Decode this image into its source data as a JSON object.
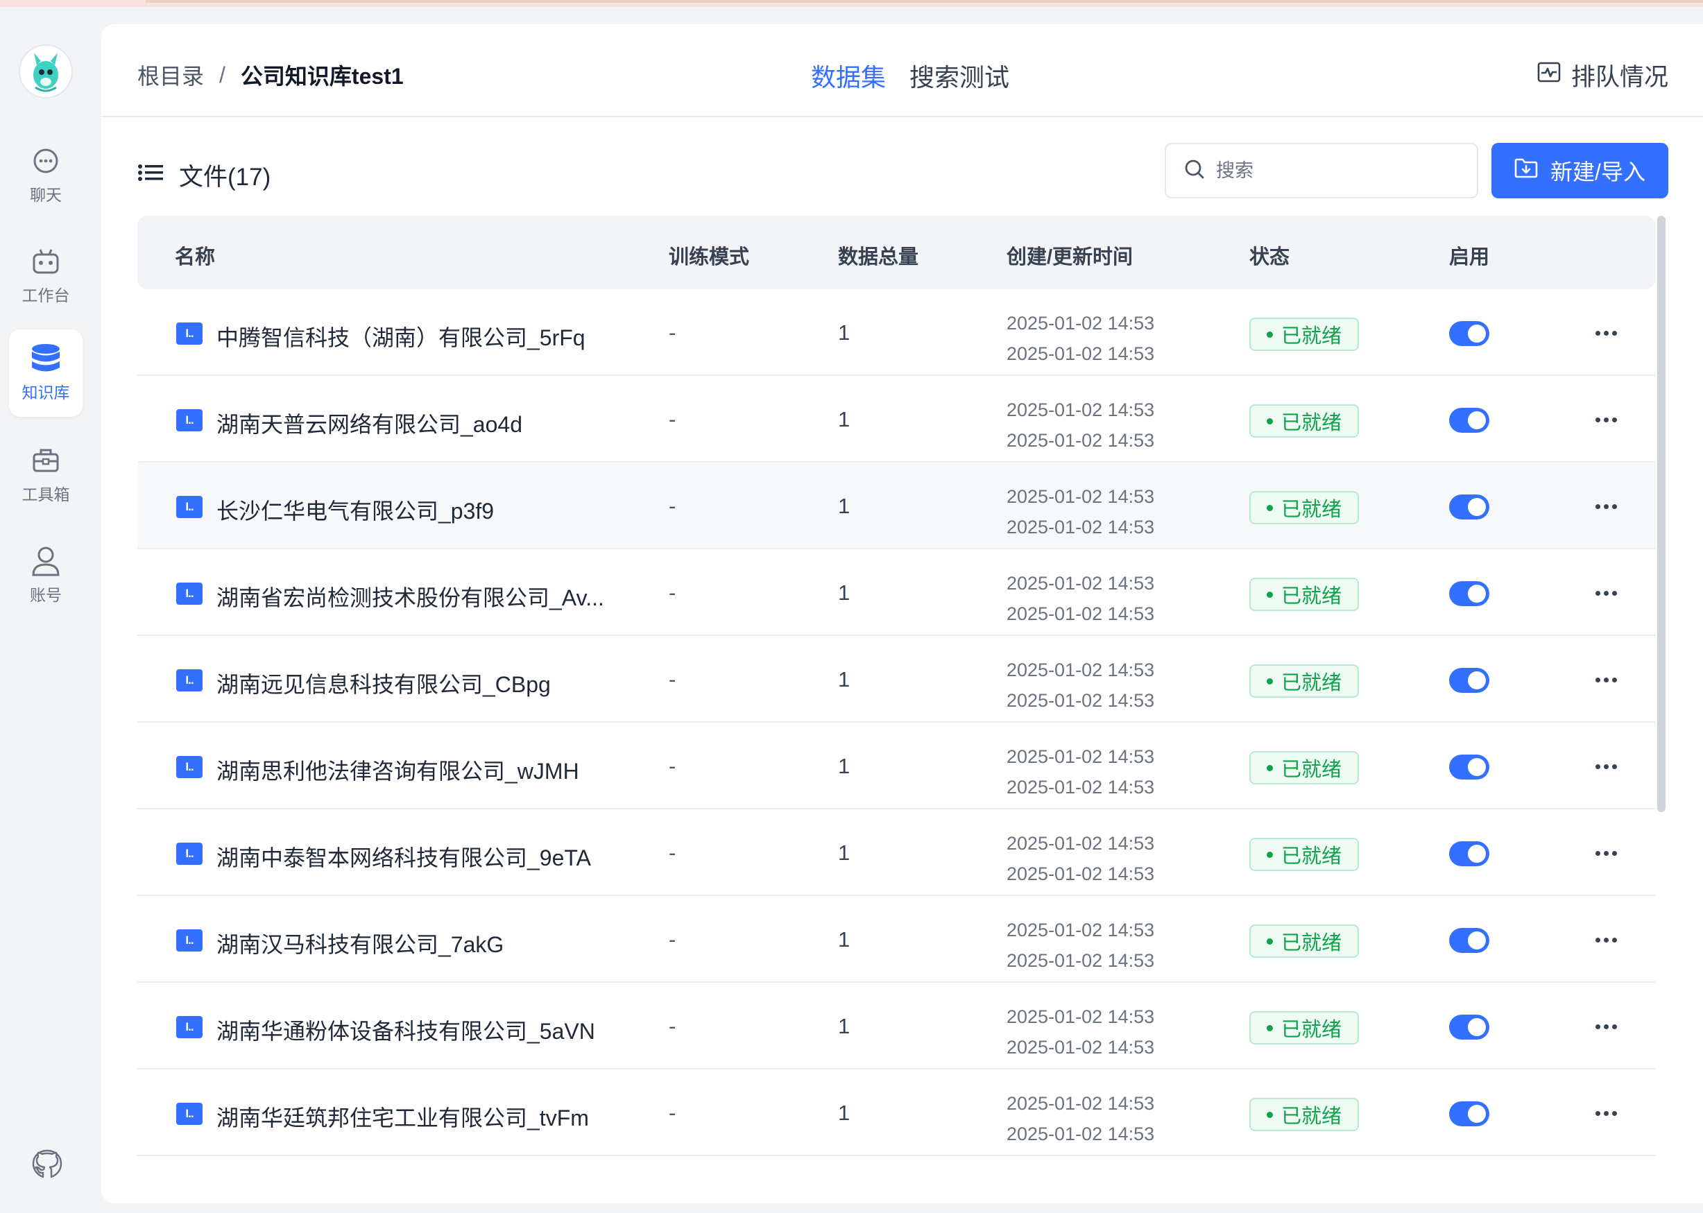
{
  "sidebar": {
    "items": [
      {
        "label": "聊天",
        "icon": "chat-icon"
      },
      {
        "label": "工作台",
        "icon": "robot-icon"
      },
      {
        "label": "知识库",
        "icon": "database-icon"
      },
      {
        "label": "工具箱",
        "icon": "toolbox-icon"
      },
      {
        "label": "账号",
        "icon": "user-icon"
      }
    ],
    "active_index": 2,
    "github_icon": "github-icon"
  },
  "header": {
    "breadcrumb_root": "根目录",
    "breadcrumb_sep": "/",
    "breadcrumb_current": "公司知识库test1",
    "tabs": [
      "数据集",
      "搜索测试"
    ],
    "active_tab": 0,
    "queue_label": "排队情况"
  },
  "toolbar": {
    "files_label": "文件(17)",
    "search_placeholder": "搜索",
    "new_button_label": "新建/导入"
  },
  "table": {
    "columns": [
      "名称",
      "训练模式",
      "数据总量",
      "创建/更新时间",
      "状态",
      "启用"
    ],
    "rows": [
      {
        "name": "中腾智信科技（湖南）有限公司_5rFq",
        "mode": "-",
        "count": "1",
        "created": "2025-01-02 14:53",
        "updated": "2025-01-02 14:53",
        "status": "已就绪",
        "enabled": true
      },
      {
        "name": "湖南天普云网络有限公司_ao4d",
        "mode": "-",
        "count": "1",
        "created": "2025-01-02 14:53",
        "updated": "2025-01-02 14:53",
        "status": "已就绪",
        "enabled": true
      },
      {
        "name": "长沙仁华电气有限公司_p3f9",
        "mode": "-",
        "count": "1",
        "created": "2025-01-02 14:53",
        "updated": "2025-01-02 14:53",
        "status": "已就绪",
        "enabled": true
      },
      {
        "name": "湖南省宏尚检测技术股份有限公司_Av...",
        "mode": "-",
        "count": "1",
        "created": "2025-01-02 14:53",
        "updated": "2025-01-02 14:53",
        "status": "已就绪",
        "enabled": true
      },
      {
        "name": "湖南远见信息科技有限公司_CBpg",
        "mode": "-",
        "count": "1",
        "created": "2025-01-02 14:53",
        "updated": "2025-01-02 14:53",
        "status": "已就绪",
        "enabled": true
      },
      {
        "name": "湖南思利他法律咨询有限公司_wJMH",
        "mode": "-",
        "count": "1",
        "created": "2025-01-02 14:53",
        "updated": "2025-01-02 14:53",
        "status": "已就绪",
        "enabled": true
      },
      {
        "name": "湖南中泰智本网络科技有限公司_9eTA",
        "mode": "-",
        "count": "1",
        "created": "2025-01-02 14:53",
        "updated": "2025-01-02 14:53",
        "status": "已就绪",
        "enabled": true
      },
      {
        "name": "湖南汉马科技有限公司_7akG",
        "mode": "-",
        "count": "1",
        "created": "2025-01-02 14:53",
        "updated": "2025-01-02 14:53",
        "status": "已就绪",
        "enabled": true
      },
      {
        "name": "湖南华通粉体设备科技有限公司_5aVN",
        "mode": "-",
        "count": "1",
        "created": "2025-01-02 14:53",
        "updated": "2025-01-02 14:53",
        "status": "已就绪",
        "enabled": true
      },
      {
        "name": "湖南华廷筑邦住宅工业有限公司_tvFm",
        "mode": "-",
        "count": "1",
        "created": "2025-01-02 14:53",
        "updated": "2025-01-02 14:53",
        "status": "已就绪",
        "enabled": true
      }
    ],
    "file_icon_text": "I..",
    "hover_row": 2
  },
  "colors": {
    "accent": "#3370ff",
    "status_green": "#10a14c"
  }
}
